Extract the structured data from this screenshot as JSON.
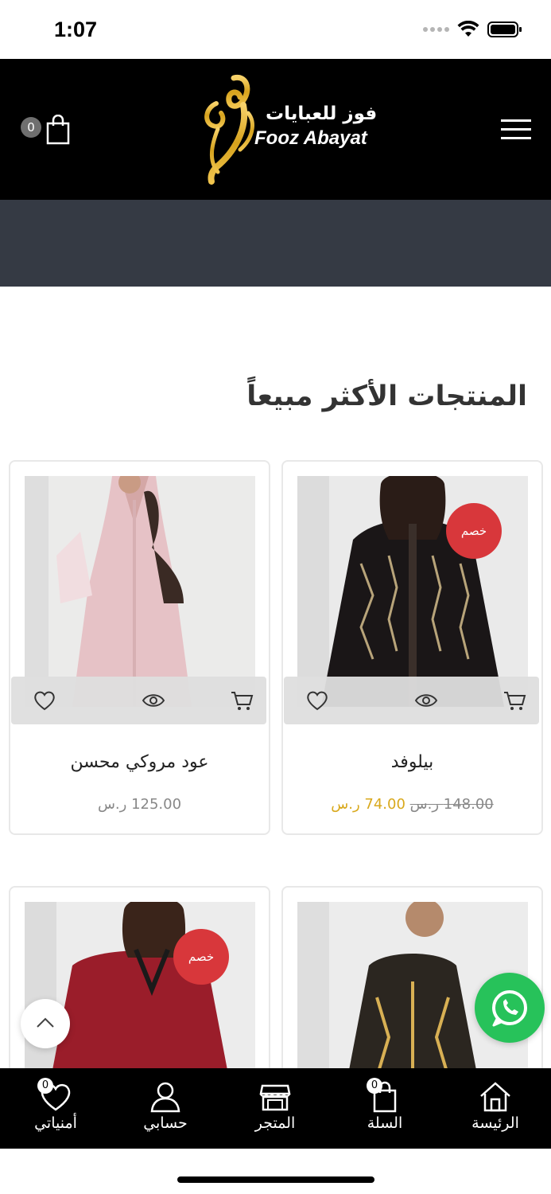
{
  "status_bar": {
    "time": "1:07"
  },
  "header": {
    "cart_count": "0",
    "logo_text_ar": "فوز للعبايات",
    "logo_text_en": "Fooz Abayat"
  },
  "section": {
    "title": "المنتجات الأكثر مبيعاً"
  },
  "products": [
    {
      "name": "عود مروكي محسن",
      "price": "125.00 ر.س",
      "on_sale": false
    },
    {
      "name": "بيلوفد",
      "price": "74.00 ر.س",
      "old_price": "148.00 ر.س",
      "sale_label": "خصم",
      "on_sale": true
    },
    {
      "sale_label": "خصم",
      "on_sale": true
    },
    {
      "on_sale": false
    }
  ],
  "colors": {
    "accent_gold": "#d9a91d",
    "sale_red": "#d8373b",
    "whatsapp_green": "#27c25a",
    "header_bg": "#000000",
    "banner_bg": "#353a44"
  },
  "bottom_nav": {
    "items": [
      {
        "label": "أمنياتي",
        "icon": "heart-icon",
        "badge": "0"
      },
      {
        "label": "حسابي",
        "icon": "user-icon"
      },
      {
        "label": "المتجر",
        "icon": "store-icon"
      },
      {
        "label": "السلة",
        "icon": "bag-icon",
        "badge": "0"
      },
      {
        "label": "الرئيسة",
        "icon": "home-icon"
      }
    ]
  }
}
